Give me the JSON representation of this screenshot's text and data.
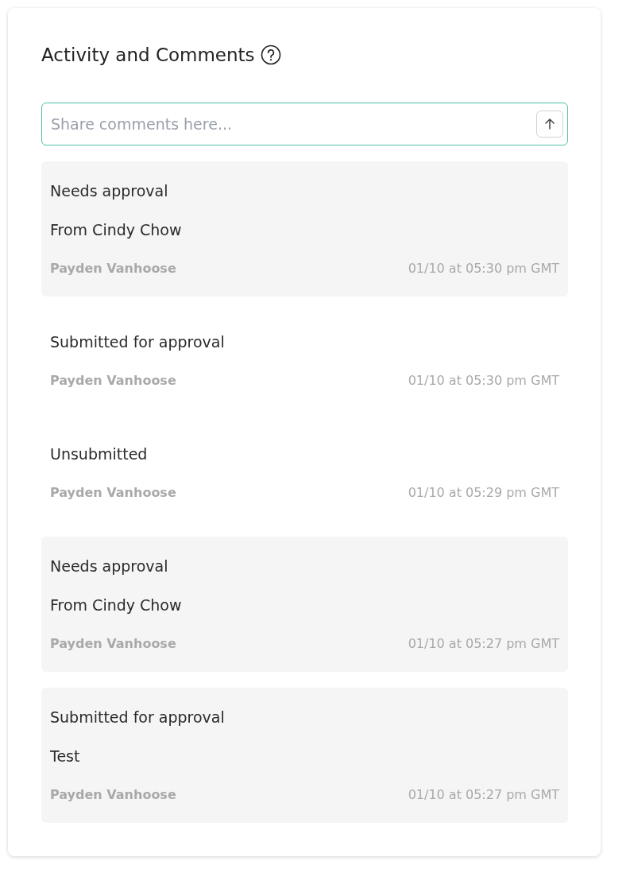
{
  "panel": {
    "title": "Activity and Comments"
  },
  "comment_field": {
    "placeholder": "Share comments here..."
  },
  "entries": [
    {
      "kind": "comment",
      "status": "Needs approval",
      "comment": "From Cindy Chow",
      "author": "Payden Vanhoose",
      "time": "01/10 at 05:30 pm GMT"
    },
    {
      "kind": "status",
      "status": "Submitted for approval",
      "author": "Payden Vanhoose",
      "time": "01/10 at 05:30 pm GMT"
    },
    {
      "kind": "status",
      "status": "Unsubmitted",
      "author": "Payden Vanhoose",
      "time": "01/10 at 05:29 pm GMT"
    },
    {
      "kind": "comment",
      "status": "Needs approval",
      "comment": "From Cindy Chow",
      "author": "Payden Vanhoose",
      "time": "01/10 at 05:27 pm GMT"
    },
    {
      "kind": "comment",
      "status": "Submitted for approval",
      "comment": "Test",
      "author": "Payden Vanhoose",
      "time": "01/10 at 05:27 pm GMT"
    }
  ]
}
